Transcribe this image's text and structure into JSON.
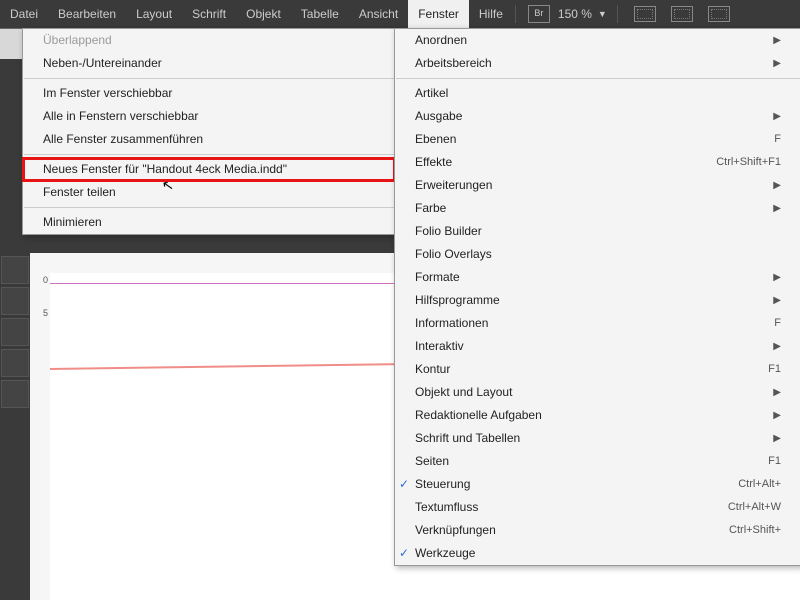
{
  "menubar": {
    "items": [
      "Datei",
      "Bearbeiten",
      "Layout",
      "Schrift",
      "Objekt",
      "Tabelle",
      "Ansicht",
      "Fenster",
      "Hilfe"
    ],
    "active": "Fenster",
    "br": "Br",
    "zoom": "150 %"
  },
  "dropdown_left": {
    "groups": [
      [
        {
          "label": "Überlappend",
          "disabled": true
        },
        {
          "label": "Neben-/Untereinander"
        }
      ],
      [
        {
          "label": "Im Fenster verschiebbar"
        },
        {
          "label": "Alle in Fenstern verschiebbar"
        },
        {
          "label": "Alle Fenster zusammenführen"
        }
      ],
      [
        {
          "label": "Neues Fenster für \"Handout 4eck Media.indd\"",
          "highlight": true
        },
        {
          "label": "Fenster teilen"
        }
      ],
      [
        {
          "label": "Minimieren"
        }
      ]
    ]
  },
  "dropdown_right": {
    "items": [
      {
        "label": "Anordnen",
        "sub": true
      },
      {
        "label": "Arbeitsbereich",
        "sub": true,
        "sepAfter": true
      },
      {
        "label": "Artikel"
      },
      {
        "label": "Ausgabe",
        "sub": true
      },
      {
        "label": "Ebenen",
        "shortcut": "F"
      },
      {
        "label": "Effekte",
        "shortcut": "Ctrl+Shift+F1"
      },
      {
        "label": "Erweiterungen",
        "sub": true
      },
      {
        "label": "Farbe",
        "sub": true
      },
      {
        "label": "Folio Builder"
      },
      {
        "label": "Folio Overlays"
      },
      {
        "label": "Formate",
        "sub": true
      },
      {
        "label": "Hilfsprogramme",
        "sub": true
      },
      {
        "label": "Informationen",
        "shortcut": "F"
      },
      {
        "label": "Interaktiv",
        "sub": true
      },
      {
        "label": "Kontur",
        "shortcut": "F1"
      },
      {
        "label": "Objekt und Layout",
        "sub": true
      },
      {
        "label": "Redaktionelle Aufgaben",
        "sub": true
      },
      {
        "label": "Schrift und Tabellen",
        "sub": true
      },
      {
        "label": "Seiten",
        "shortcut": "F1"
      },
      {
        "label": "Steuerung",
        "checked": true,
        "shortcut": "Ctrl+Alt+"
      },
      {
        "label": "Textumfluss",
        "shortcut": "Ctrl+Alt+W"
      },
      {
        "label": "Verknüpfungen",
        "shortcut": "Ctrl+Shift+"
      },
      {
        "label": "Werkzeuge",
        "checked": true
      }
    ]
  },
  "ruler": {
    "ticks": [
      "0",
      "5"
    ]
  }
}
